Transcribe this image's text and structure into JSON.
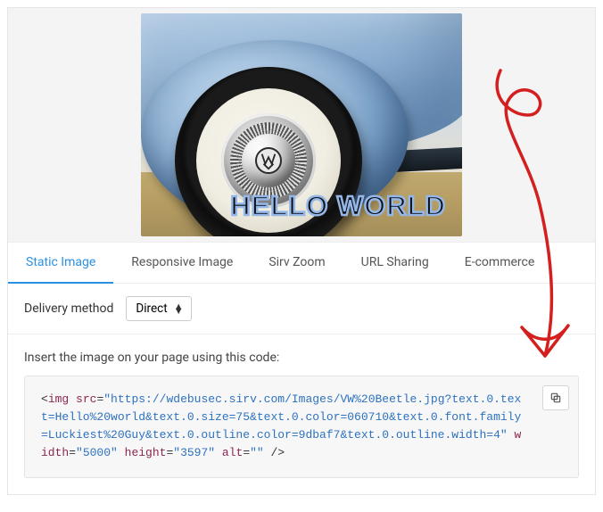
{
  "preview": {
    "overlay_text": "Hello world",
    "logo_name": "vw-logo"
  },
  "tabs": [
    {
      "label": "Static Image",
      "active": true
    },
    {
      "label": "Responsive Image",
      "active": false
    },
    {
      "label": "Sirv Zoom",
      "active": false
    },
    {
      "label": "URL Sharing",
      "active": false
    },
    {
      "label": "E-commerce",
      "active": false
    }
  ],
  "delivery": {
    "label": "Delivery method",
    "selected": "Direct"
  },
  "instruction": "Insert the image on your page using this code:",
  "code": {
    "lt": "<",
    "gt": " />",
    "tag_open": "img",
    "attr_src": "src",
    "val_src": "\"https://wdebusec.sirv.com/Images/VW%20Beetle.jpg?text.0.text=Hello%20world&text.0.size=75&text.0.color=060710&text.0.font.family=Luckiest%20Guy&text.0.outline.color=9dbaf7&text.0.outline.width=4\"",
    "attr_width": "width",
    "val_width": "\"5000\"",
    "attr_height": "height",
    "val_height": "\"3597\"",
    "attr_alt": "alt",
    "val_alt": "\"\""
  },
  "copy_button_title": "Copy"
}
